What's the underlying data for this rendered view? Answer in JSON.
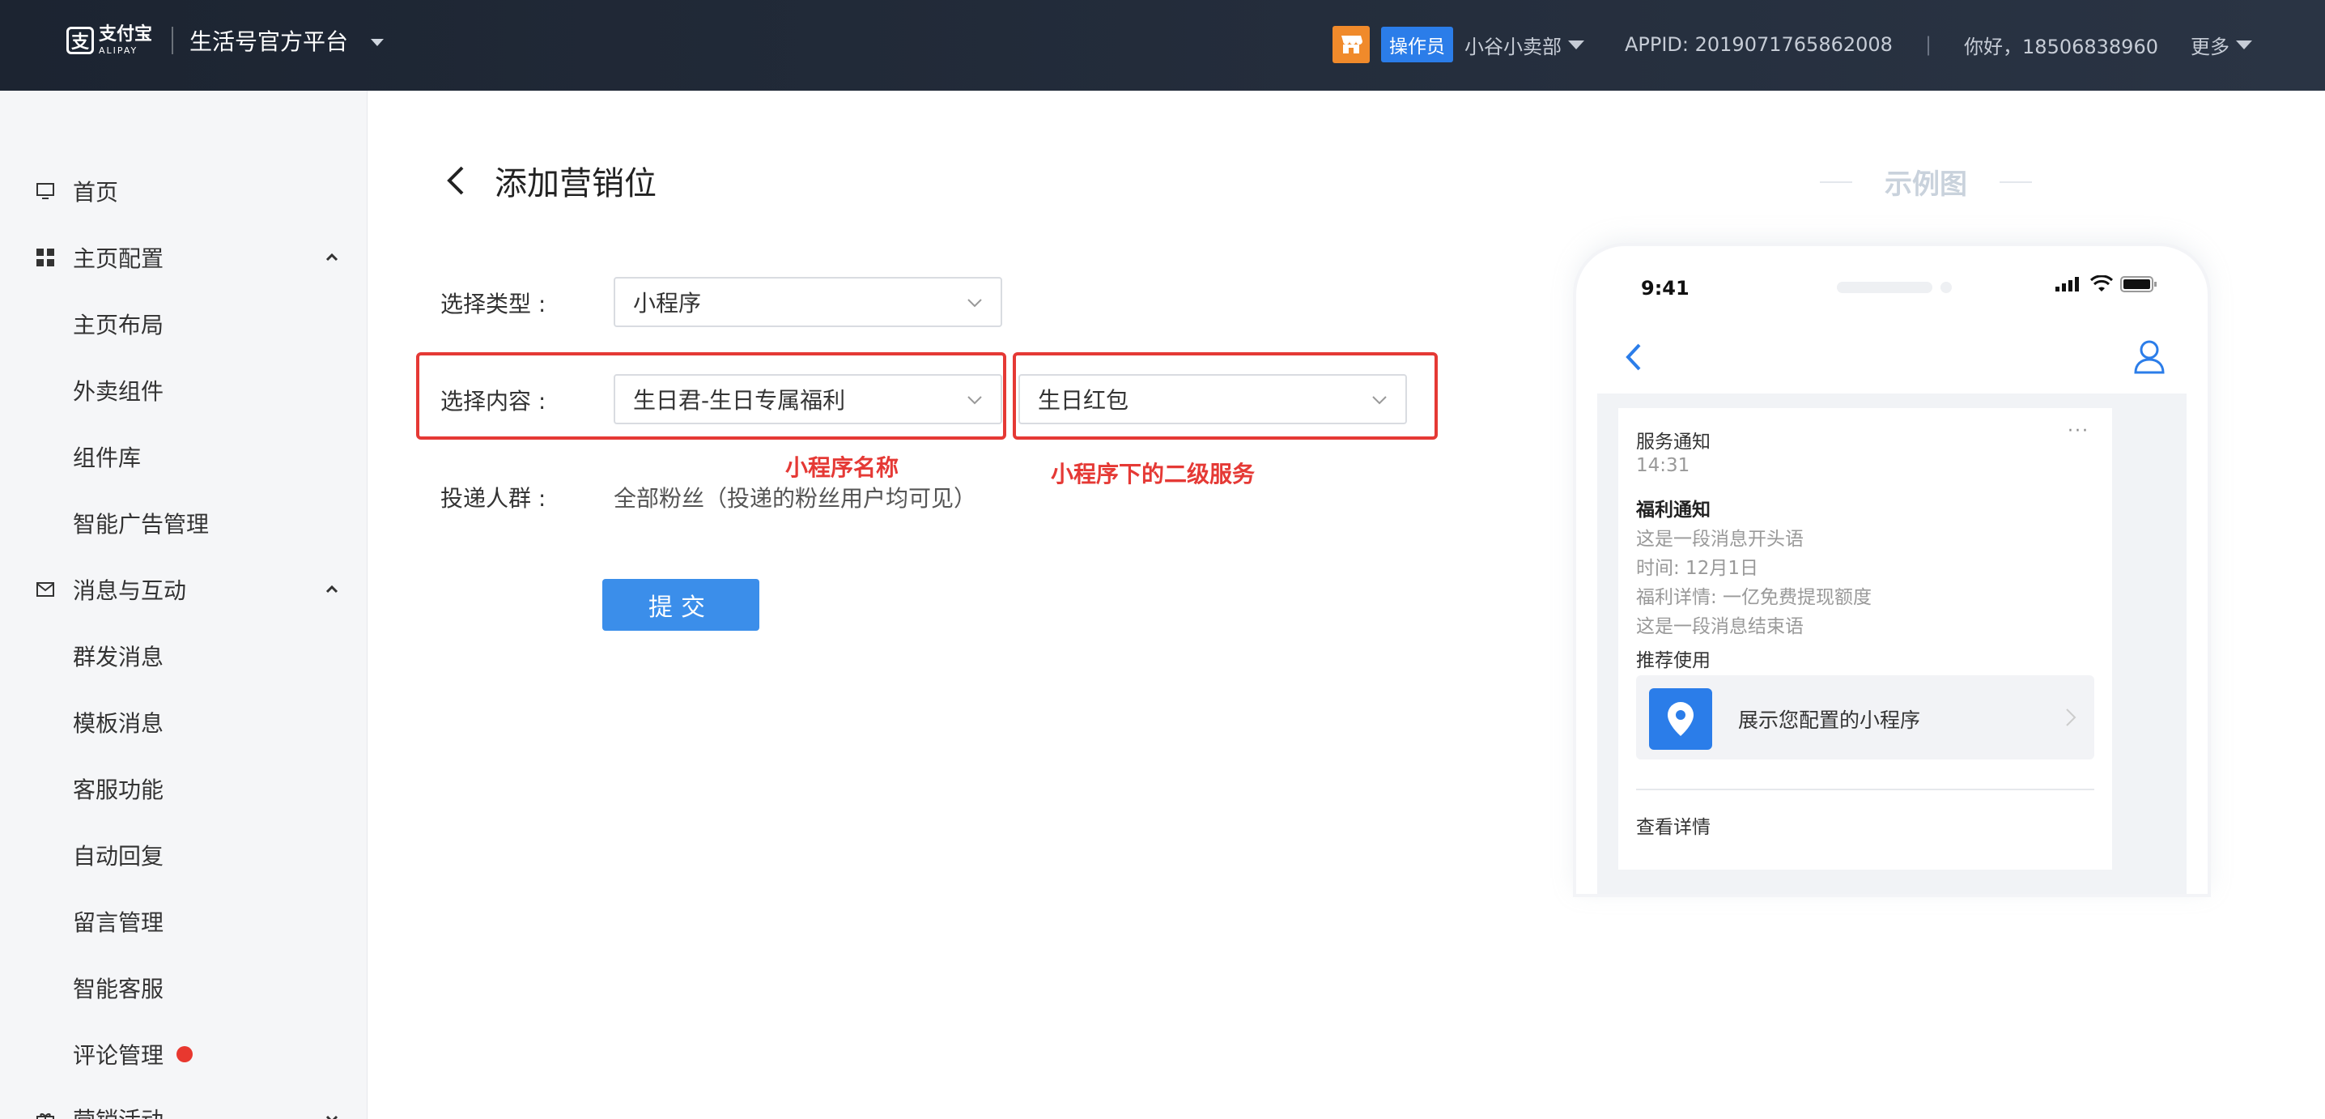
{
  "header": {
    "logo_cn": "支付宝",
    "logo_en": "ALIPAY",
    "platform_title": "生活号官方平台",
    "role_badge": "操作员",
    "shop_name": "小谷小卖部",
    "appid": "APPID: 2019071765862008",
    "separator": "|",
    "greeting": "你好，18506838960",
    "more": "更多"
  },
  "sidebar": {
    "items": [
      {
        "label": "首页",
        "icon": "monitor-icon"
      },
      {
        "label": "主页配置",
        "icon": "grid-icon",
        "expanded": true
      },
      {
        "label": "主页布局"
      },
      {
        "label": "外卖组件"
      },
      {
        "label": "组件库"
      },
      {
        "label": "智能广告管理"
      },
      {
        "label": "消息与互动",
        "icon": "mail-icon",
        "expanded": true
      },
      {
        "label": "群发消息"
      },
      {
        "label": "模板消息"
      },
      {
        "label": "客服功能"
      },
      {
        "label": "自动回复"
      },
      {
        "label": "留言管理"
      },
      {
        "label": "智能客服"
      },
      {
        "label": "评论管理",
        "badge": "red-dot"
      },
      {
        "label": "营销活动",
        "icon": "gift-icon",
        "expanded": false
      }
    ]
  },
  "page": {
    "title": "添加营销位",
    "form": {
      "type_label": "选择类型 :",
      "type_value": "小程序",
      "content_label": "选择内容 :",
      "content_value": "生日君-生日专属福利",
      "service_value": "生日红包",
      "audience_label": "投递人群 :",
      "audience_value": "全部粉丝（投递的粉丝用户均可见）",
      "submit_label": "提交"
    },
    "annotations": {
      "app_name": "小程序名称",
      "secondary_service": "小程序下的二级服务"
    }
  },
  "preview": {
    "title": "示例图",
    "status_time": "9:41",
    "card": {
      "header": "服务通知",
      "time": "14:31",
      "title": "福利通知",
      "line1": "这是一段消息开头语",
      "line2": "时间: 12月1日",
      "line3": "福利详情: 一亿免费提现额度",
      "line4": "这是一段消息结束语",
      "recommend": "推荐使用",
      "mini_app_label": "展示您配置的小程序",
      "details": "查看详情",
      "more_dots": "···"
    }
  },
  "colors": {
    "accent": "#3b8eea",
    "highlight": "#e53935",
    "store": "#f08a2b",
    "topbar": "#222b38"
  }
}
